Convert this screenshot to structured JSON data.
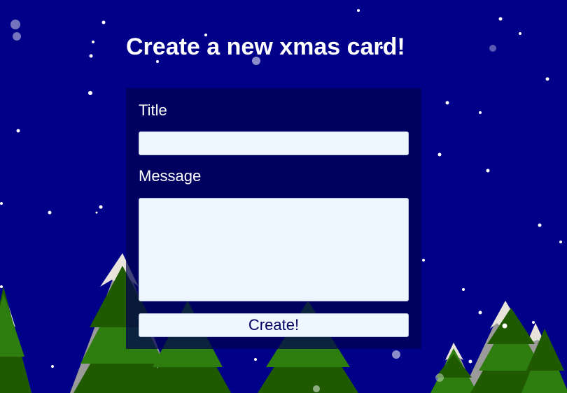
{
  "page": {
    "title": "Create a new xmas card!"
  },
  "form": {
    "title_label": "Title",
    "title_value": "",
    "message_label": "Message",
    "message_value": "",
    "submit_label": "Create!"
  },
  "colors": {
    "background": "#000089",
    "form_panel": "#000050",
    "input_fill": "#eef6ff",
    "button_text": "#000060",
    "tree_dark": "#1f5a00",
    "tree_light": "#2e7d0f",
    "trunk": "#8b4a10",
    "mountain_snow": "#e8e4dc",
    "mountain_rock": "#9a9a9a",
    "snowflake": "#ffffff"
  },
  "icons": {
    "decorations": [
      "snowflake-icon",
      "pine-tree-icon",
      "snowy-mountain-icon"
    ]
  }
}
